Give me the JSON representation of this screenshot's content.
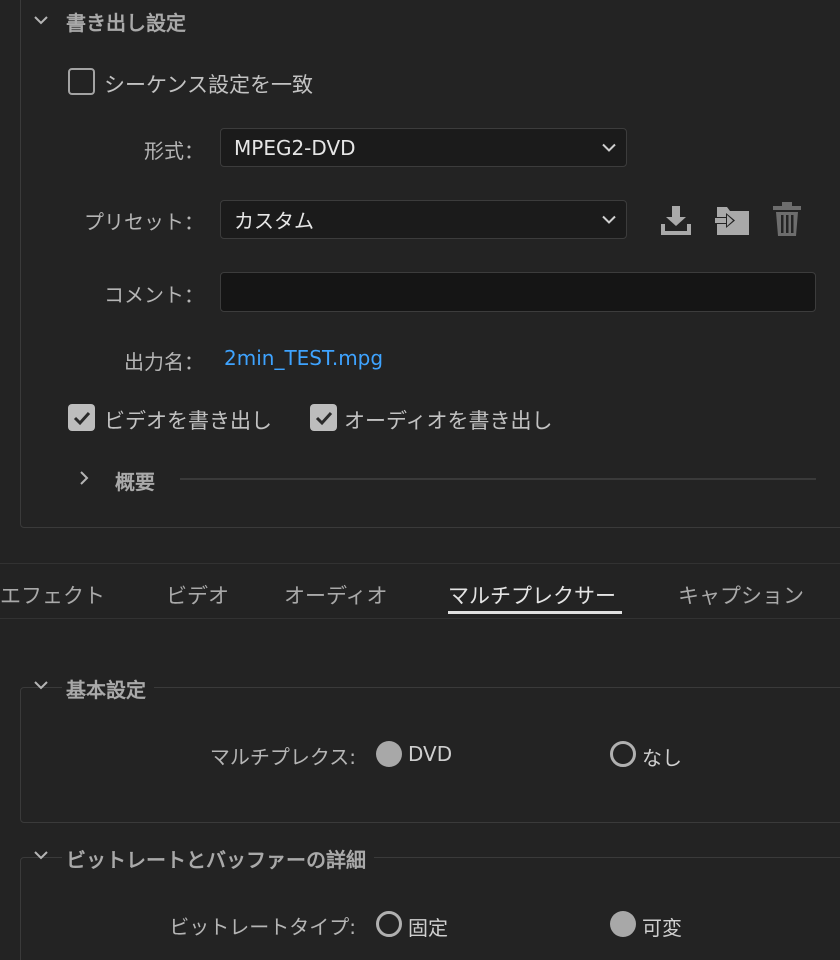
{
  "export_settings": {
    "title": "書き出し設定",
    "match_sequence_label": "シーケンス設定を一致",
    "match_sequence_checked": false,
    "format_label": "形式：",
    "format_value": "MPEG2-DVD",
    "preset_label": "プリセット：",
    "preset_value": "カスタム",
    "comment_label": "コメント：",
    "comment_value": "",
    "output_name_label": "出力名：",
    "output_name_value": "2min_TEST.mpg",
    "export_video_label": "ビデオを書き出し",
    "export_video_checked": true,
    "export_audio_label": "オーディオを書き出し",
    "export_audio_checked": true,
    "summary_label": "概要",
    "icons": [
      "save-preset-icon",
      "import-preset-icon",
      "delete-preset-icon"
    ]
  },
  "tabs": {
    "items": [
      "エフェクト",
      "ビデオ",
      "オーディオ",
      "マルチプレクサー",
      "キャプション"
    ],
    "active": "マルチプレクサー"
  },
  "basic_settings": {
    "title": "基本設定",
    "multiplex_label": "マルチプレクス:",
    "option_dvd": "DVD",
    "option_none": "なし",
    "selected": "DVD"
  },
  "bitrate": {
    "title": "ビットレートとバッファーの詳細",
    "type_label": "ビットレートタイプ:",
    "option_fixed": "固定",
    "option_variable": "可変",
    "selected": "可変"
  },
  "colors": {
    "background": "#232323",
    "link": "#3ea3ff",
    "active_tab_underline": "#e0e0e0"
  }
}
